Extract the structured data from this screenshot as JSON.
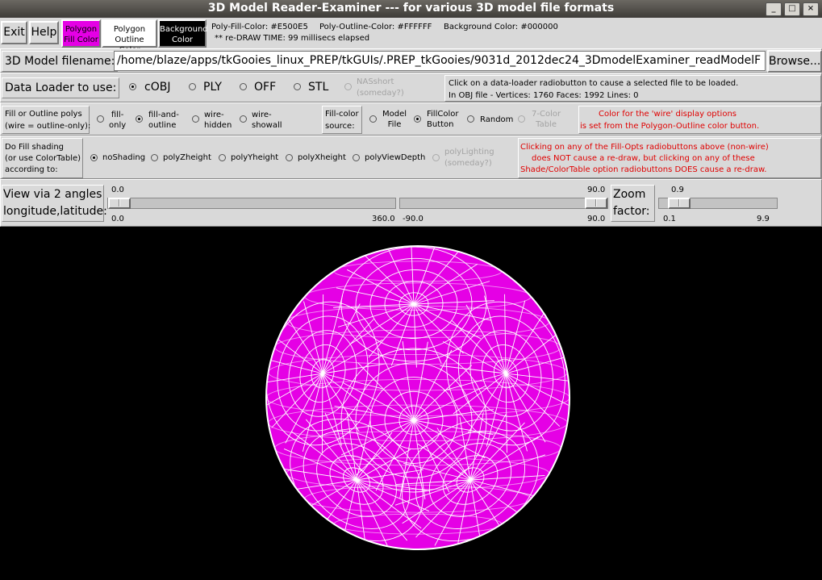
{
  "window": {
    "title": "3D Model Reader-Examiner --- for various 3D model file formats",
    "min": "_",
    "max": "□",
    "close": "×"
  },
  "toolbar": {
    "exit": "Exit",
    "help": "Help",
    "poly_fill_line1": "Polygon",
    "poly_fill_line2": "Fill Color",
    "poly_outline_line1": "Polygon",
    "poly_outline_line2": "Outline Color",
    "background_line1": "Background",
    "background_line2": "Color",
    "info_fill": "Poly-Fill-Color: #E500E5",
    "info_outline": "Poly-Outline-Color: #FFFFFF",
    "info_bg": "Background Color: #000000",
    "redraw": "** re-DRAW TIME: 99 millisecs elapsed"
  },
  "colors": {
    "fill": "#E500E5",
    "outline": "#FFFFFF",
    "background": "#000000"
  },
  "file": {
    "label": "3D Model filename:",
    "value": "/home/blaze/apps/tkGooies_linux_PREP/tkGUIs/.PREP_tkGooies/9031d_2012dec24_3DmodelExaminer_readModelF",
    "browse": "Browse..."
  },
  "loader": {
    "label": "Data Loader to use:",
    "options": [
      "cOBJ",
      "PLY",
      "OFF",
      "STL"
    ],
    "nas1": "NASshort",
    "nas2": "(someday?)",
    "info1": "Click on a data-loader radiobutton to cause a selected file to be loaded.",
    "info2": "In OBJ file - Vertices: 1760   Faces: 1992  Lines: 0"
  },
  "fill_opts": {
    "label1": "Fill or Outline polys",
    "label2": "(wire = outline-only):",
    "o1a": "fill-",
    "o1b": "only",
    "o2a": "fill-and-",
    "o2b": "outline",
    "o3a": "wire-",
    "o3b": "hidden",
    "o4a": "wire-",
    "o4b": "showall",
    "src1": "Fill-color",
    "src2": "source:",
    "s1a": "Model",
    "s1b": "File",
    "s2a": "FillColor",
    "s2b": "Button",
    "s3": "Random",
    "s4a": "7-Color",
    "s4b": "Table",
    "note1": "Color for the 'wire' display options",
    "note2": "is set from the Polygon-Outline color button."
  },
  "shading": {
    "label1": "Do Fill shading",
    "label2": "(or use ColorTable)",
    "label3": "according to:",
    "options": [
      "noShading",
      "polyZheight",
      "polyYheight",
      "polyXheight",
      "polyViewDepth"
    ],
    "light1": "polyLighting",
    "light2": "(someday?)",
    "note1": "Clicking on any of the Fill-Opts radiobuttons above (non-wire)",
    "note2": "does NOT cause a re-draw, but clicking on any of these",
    "note3": "Shade/ColorTable option radiobuttons DOES cause a re-draw."
  },
  "view": {
    "label1": "View via 2 angles",
    "label2": "longitude,latitude:",
    "lon_value": "0.0",
    "lon_min": "0.0",
    "lon_max": "360.0",
    "lat_value": "90.0",
    "lat_min": "-90.0",
    "lat_max": "90.0",
    "zoom1": "Zoom",
    "zoom2": "factor:",
    "zoom_value": "0.9",
    "zoom_min": "0.1",
    "zoom_max": "9.9"
  }
}
